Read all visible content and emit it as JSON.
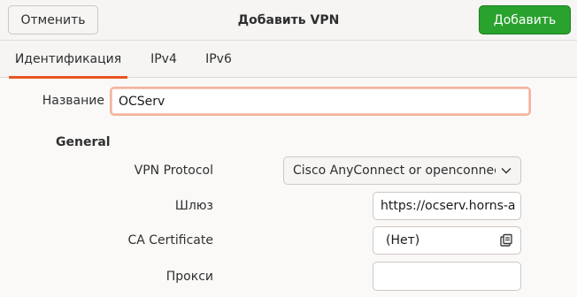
{
  "header": {
    "cancel_label": "Отменить",
    "title": "Добавить VPN",
    "add_label": "Добавить"
  },
  "tabs": [
    {
      "label": "Идентификация",
      "active": true
    },
    {
      "label": "IPv4",
      "active": false
    },
    {
      "label": "IPv6",
      "active": false
    }
  ],
  "form": {
    "name_label": "Название",
    "name_value": "OCServ",
    "section_title": "General",
    "protocol_label": "VPN Protocol",
    "protocol_value": "Cisco AnyConnect or openconnect",
    "gateway_label": "Шлюз",
    "gateway_value": "https://ocserv.horns-a",
    "ca_label": "CA Certificate",
    "ca_value": "(Нет)",
    "proxy_label": "Прокси",
    "proxy_value": ""
  },
  "icons": {
    "combo_arrow": "chevron-down-icon",
    "file_chooser": "document-open-icon"
  },
  "colors": {
    "accent": "#e95420",
    "suggested_action": "#2aa22e",
    "focus_ring": "#f3b49f"
  }
}
